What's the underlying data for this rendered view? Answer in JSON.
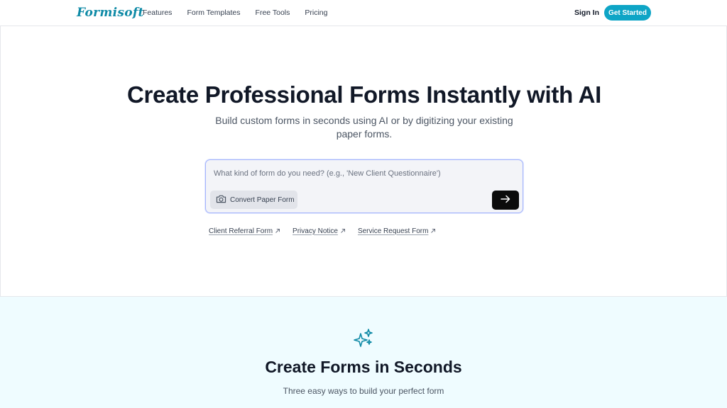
{
  "brand": {
    "logo": "Formisoft",
    "accent": "#0ea5c6"
  },
  "nav": {
    "links": [
      "Features",
      "Form Templates",
      "Free Tools",
      "Pricing"
    ],
    "signin": "Sign In",
    "cta": "Get Started"
  },
  "hero": {
    "title": "Create Professional Forms Instantly with AI",
    "subtitle": "Build custom forms in seconds using AI or by digitizing your existing paper forms.",
    "prompt": {
      "placeholder": "What kind of form do you need? (e.g., 'New Client Questionnaire')",
      "value": "",
      "convert_label": "Convert Paper Form",
      "convert_icon": "camera-icon",
      "submit_icon": "arrow-right-icon"
    },
    "suggestions": [
      {
        "label": "Client Referral Form",
        "icon": "external-arrow-icon"
      },
      {
        "label": "Privacy Notice",
        "icon": "external-arrow-icon"
      },
      {
        "label": "Service Request Form",
        "icon": "external-arrow-icon"
      }
    ]
  },
  "features": {
    "icon": "sparkles-icon",
    "title": "Create Forms in Seconds",
    "subtitle": "Three easy ways to build your perfect form"
  }
}
